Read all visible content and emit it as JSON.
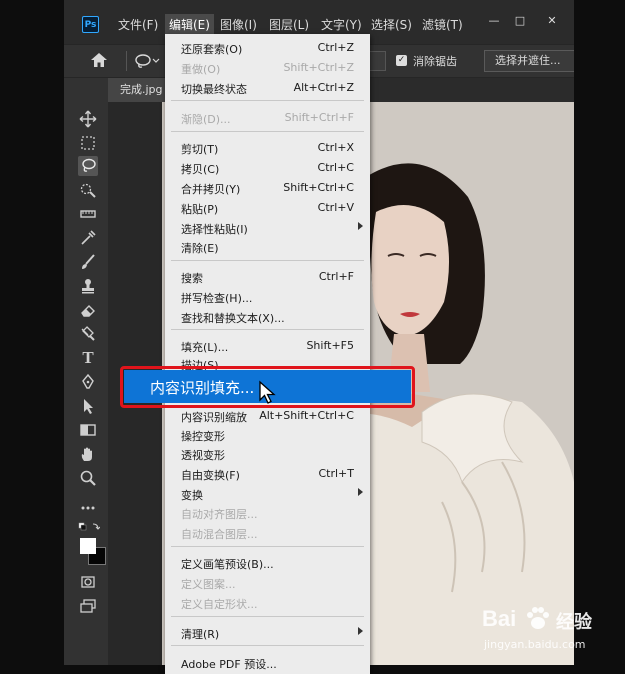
{
  "menubar": {
    "logo": "Ps",
    "items": [
      "文件(F)",
      "编辑(E)",
      "图像(I)",
      "图层(L)",
      "文字(Y)",
      "选择(S)",
      "滤镜(T)"
    ],
    "window_controls": [
      "—",
      "□",
      "✕"
    ]
  },
  "options": {
    "antialias_label": "消除锯齿",
    "select_mask_label": "选择并遮住..."
  },
  "document": {
    "tab_label": "完成.jpg"
  },
  "edit_menu": {
    "items": [
      {
        "label": "还原套索(O)",
        "shortcut": "Ctrl+Z",
        "disabled": false
      },
      {
        "label": "重做(O)",
        "shortcut": "Shift+Ctrl+Z",
        "disabled": true
      },
      {
        "label": "切换最终状态",
        "shortcut": "Alt+Ctrl+Z",
        "disabled": false
      },
      {
        "label": "渐隐(D)...",
        "shortcut": "Shift+Ctrl+F",
        "disabled": true
      },
      {
        "label": "剪切(T)",
        "shortcut": "Ctrl+X",
        "disabled": false
      },
      {
        "label": "拷贝(C)",
        "shortcut": "Ctrl+C",
        "disabled": false
      },
      {
        "label": "合并拷贝(Y)",
        "shortcut": "Shift+Ctrl+C",
        "disabled": false
      },
      {
        "label": "粘贴(P)",
        "shortcut": "Ctrl+V",
        "disabled": false
      },
      {
        "label": "选择性粘贴(I)",
        "shortcut": "",
        "disabled": false,
        "submenu": true
      },
      {
        "label": "清除(E)",
        "shortcut": "",
        "disabled": false
      },
      {
        "label": "搜索",
        "shortcut": "Ctrl+F",
        "disabled": false
      },
      {
        "label": "拼写检查(H)...",
        "shortcut": "",
        "disabled": false
      },
      {
        "label": "查找和替换文本(X)...",
        "shortcut": "",
        "disabled": false
      },
      {
        "label": "填充(L)...",
        "shortcut": "Shift+F5",
        "disabled": false
      },
      {
        "label": "描边(S)...",
        "shortcut": "",
        "disabled": false
      },
      {
        "label": "内容识别填充...",
        "shortcut": "",
        "disabled": false,
        "highlighted": true
      },
      {
        "label": "内容识别缩放",
        "shortcut": "Alt+Shift+Ctrl+C",
        "disabled": false
      },
      {
        "label": "操控变形",
        "shortcut": "",
        "disabled": false
      },
      {
        "label": "透视变形",
        "shortcut": "",
        "disabled": false
      },
      {
        "label": "自由变换(F)",
        "shortcut": "Ctrl+T",
        "disabled": false
      },
      {
        "label": "变换",
        "shortcut": "",
        "disabled": false,
        "submenu": true
      },
      {
        "label": "自动对齐图层...",
        "shortcut": "",
        "disabled": true
      },
      {
        "label": "自动混合图层...",
        "shortcut": "",
        "disabled": true
      },
      {
        "label": "定义画笔预设(B)...",
        "shortcut": "",
        "disabled": false
      },
      {
        "label": "定义图案...",
        "shortcut": "",
        "disabled": true
      },
      {
        "label": "定义自定形状...",
        "shortcut": "",
        "disabled": true
      },
      {
        "label": "清理(R)",
        "shortcut": "",
        "disabled": false,
        "submenu": true
      },
      {
        "label": "Adobe PDF 预设...",
        "shortcut": "",
        "disabled": false
      }
    ]
  },
  "watermark": {
    "brand": "Bai",
    "brand_suffix": "经验",
    "url": "jingyan.baidu.com"
  },
  "colors": {
    "accent": "#0e74d6",
    "highlight_border": "#e0141b",
    "menu_bg": "#ececec"
  }
}
